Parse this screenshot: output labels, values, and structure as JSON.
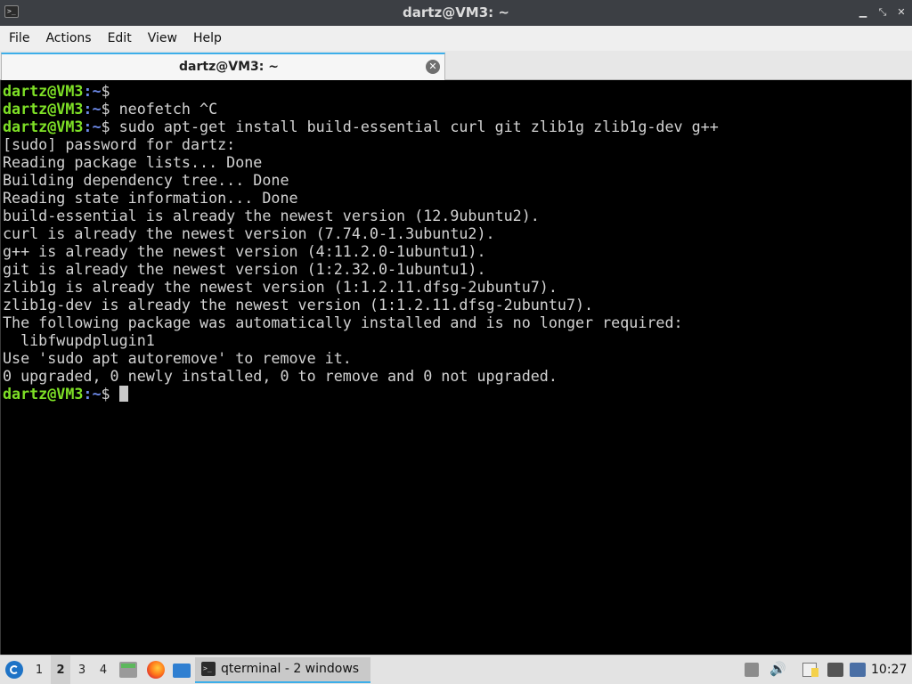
{
  "window": {
    "title": "dartz@VM3: ~",
    "controls": {
      "minimize": "minimize-icon",
      "maximize": "maximize-icon",
      "close": "close-icon"
    }
  },
  "menubar": [
    "File",
    "Actions",
    "Edit",
    "View",
    "Help"
  ],
  "tab": {
    "label": "dartz@VM3: ~"
  },
  "terminal": {
    "prompt": {
      "user_host": "dartz@VM3",
      "path": ":~",
      "symbol": "$"
    },
    "commands": {
      "c0": "",
      "c1": " neofetch ^C",
      "c2": " sudo apt-get install build-essential curl git zlib1g zlib1g-dev g++",
      "c3": " "
    },
    "output": [
      "[sudo] password for dartz:",
      "Reading package lists... Done",
      "Building dependency tree... Done",
      "Reading state information... Done",
      "build-essential is already the newest version (12.9ubuntu2).",
      "curl is already the newest version (7.74.0-1.3ubuntu2).",
      "g++ is already the newest version (4:11.2.0-1ubuntu1).",
      "git is already the newest version (1:2.32.0-1ubuntu1).",
      "zlib1g is already the newest version (1:1.2.11.dfsg-2ubuntu7).",
      "zlib1g-dev is already the newest version (1:1.2.11.dfsg-2ubuntu7).",
      "The following package was automatically installed and is no longer required:",
      "  libfwupdplugin1",
      "Use 'sudo apt autoremove' to remove it.",
      "0 upgraded, 0 newly installed, 0 to remove and 0 not upgraded."
    ]
  },
  "taskbar": {
    "workspaces": [
      "1",
      "2",
      "3",
      "4"
    ],
    "active_workspace": "2",
    "task_label": "qterminal - 2 windows",
    "clock": "10:27",
    "accent": "#3daee9"
  }
}
